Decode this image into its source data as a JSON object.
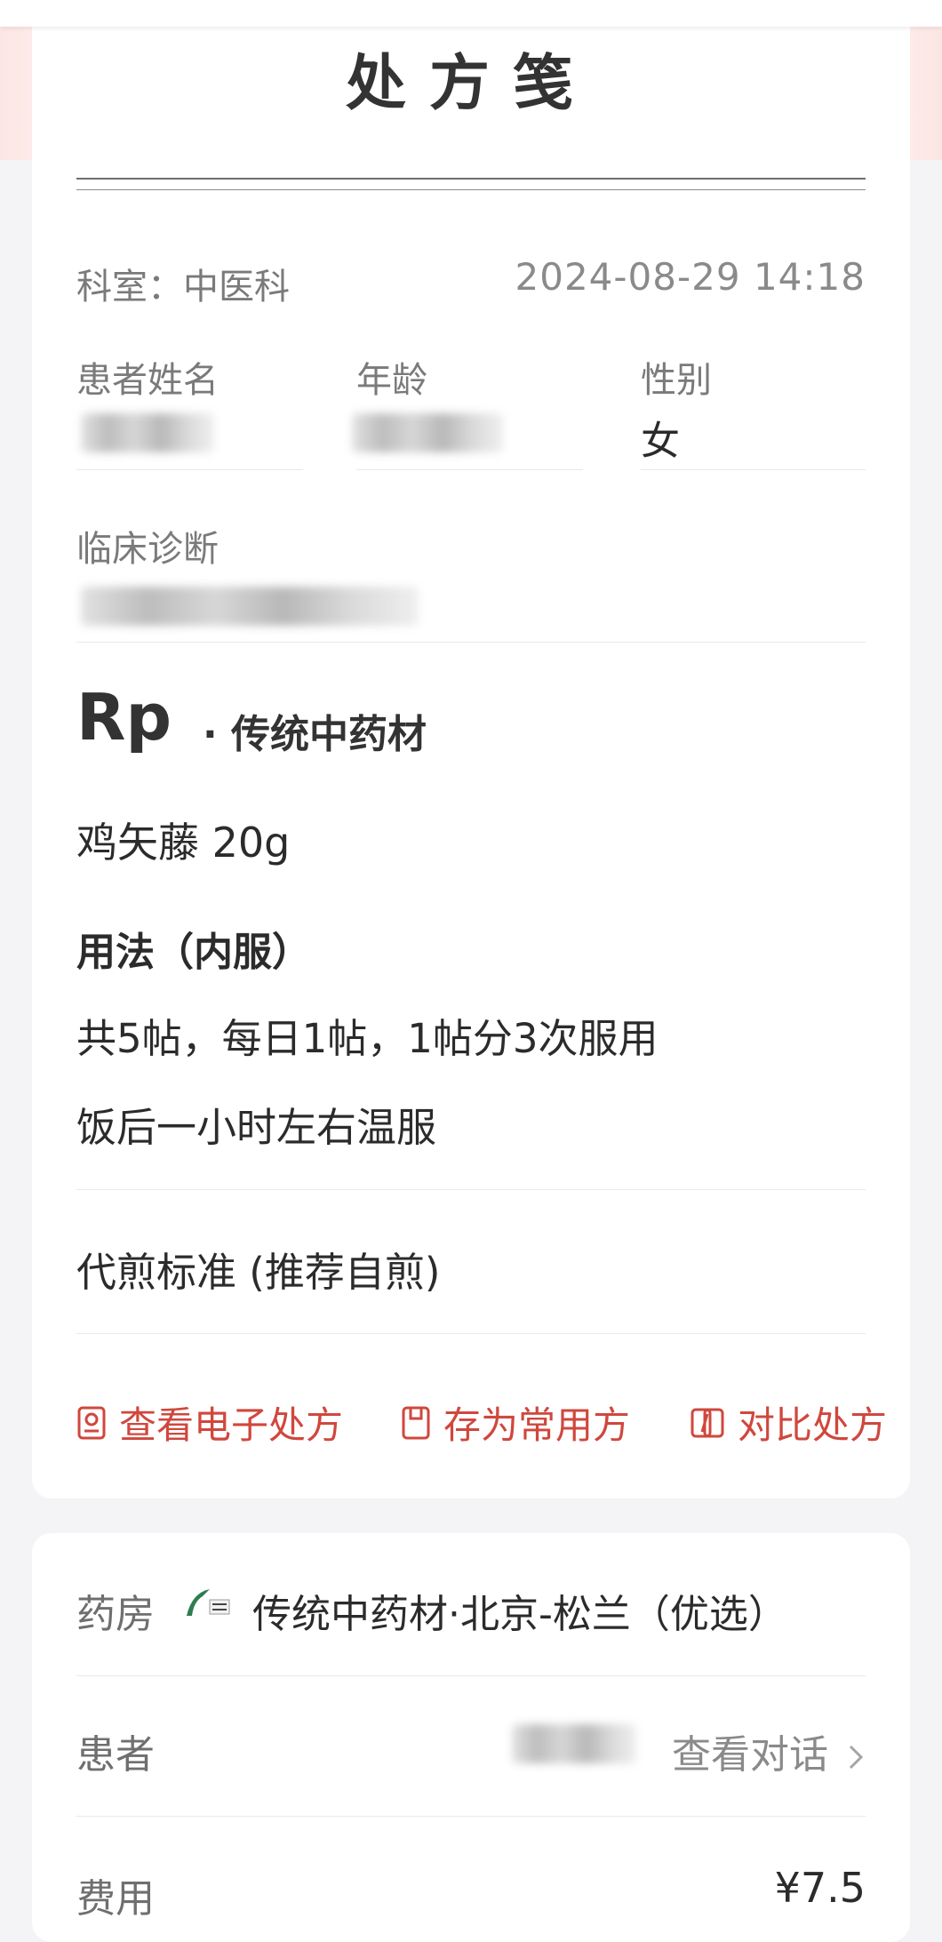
{
  "prescription": {
    "title": "处方笺",
    "department": "科室：中医科",
    "datetime": "2024-08-29 14:18",
    "patient_name_label": "患者姓名",
    "age_label": "年龄",
    "gender_label": "性别",
    "gender_value": "女",
    "diagnosis_label": "临床诊断",
    "rp_label": "Rp",
    "rp_category": "· 传统中药材",
    "herbs": [
      "鸡矢藤 20g"
    ],
    "usage_title": "用法（内服）",
    "usage_lines": [
      "共5帖，每日1帖，1帖分3次服用",
      "饭后一小时左右温服"
    ],
    "decoction": "代煎标准 (推荐自煎)",
    "actions": {
      "view_eprescription": "查看电子处方",
      "save_common": "存为常用方",
      "compare": "对比处方"
    }
  },
  "order": {
    "pharmacy_label": "药房",
    "pharmacy_name": "传统中药材·北京-松兰（优选）",
    "patient_label": "患者",
    "view_chat": "查看对话",
    "fee_label": "费用",
    "fee_value": "¥7.5"
  },
  "colors": {
    "accent": "#d0473d",
    "background": "#f4f4f6",
    "card": "#ffffff"
  }
}
